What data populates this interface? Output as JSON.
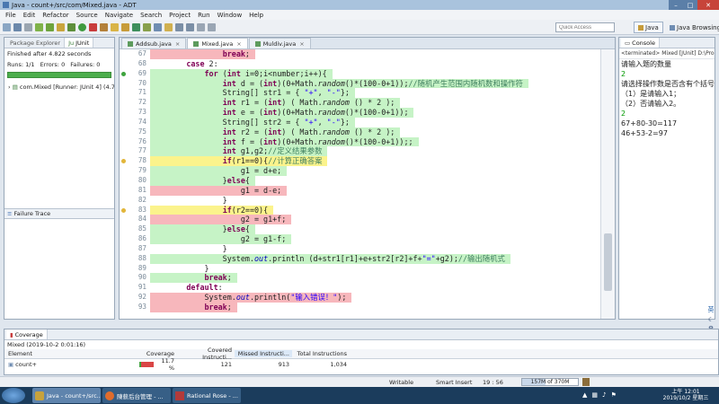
{
  "window": {
    "title": "Java - count+/src/com/Mixed.java - ADT"
  },
  "menu": [
    "File",
    "Edit",
    "Refactor",
    "Source",
    "Navigate",
    "Search",
    "Project",
    "Run",
    "Window",
    "Help"
  ],
  "toolbar": {
    "quick_access_placeholder": "Quick Access",
    "perspectives": [
      "Java",
      "Java Browsing"
    ]
  },
  "left_panel": {
    "tabs": [
      "Package Explorer",
      "JUnit"
    ],
    "finished": "Finished after 4.822 seconds",
    "runs": "Runs: 1/1",
    "errors": "Errors: 0",
    "failures": "Failures: 0",
    "tree_item": "com.Mixed [Runner: JUnit 4] (4.702",
    "failure_trace": "Failure Trace"
  },
  "editor": {
    "tabs": [
      "Addsub.java",
      "Mixed.java",
      "Muldiv.java"
    ],
    "active_tab": 1,
    "lines": [
      {
        "n": "67",
        "cov": "red",
        "code": "                break;"
      },
      {
        "n": "68",
        "cov": "",
        "code": "        case 2:"
      },
      {
        "n": "69",
        "cov": "green",
        "code": "            for (int i=0;i<number;i++){"
      },
      {
        "n": "70",
        "cov": "green",
        "code": "                int d = (int)(0+Math.random()*(100-0+1));//随机产生范围内随机数和操作符"
      },
      {
        "n": "71",
        "cov": "green",
        "code": "                String[] str1 = { \"+\", \"-\"};"
      },
      {
        "n": "72",
        "cov": "green",
        "code": "                int r1 = (int) ( Math.random () * 2 );"
      },
      {
        "n": "73",
        "cov": "green",
        "code": "                int e = (int)(0+Math.random()*(100-0+1));"
      },
      {
        "n": "74",
        "cov": "green",
        "code": "                String[] str2 = { \"+\", \"-\"};"
      },
      {
        "n": "75",
        "cov": "green",
        "code": "                int r2 = (int) ( Math.random () * 2 );"
      },
      {
        "n": "76",
        "cov": "green",
        "code": "                int f = (int)(0+Math.random()*(100-0+1));;"
      },
      {
        "n": "77",
        "cov": "green",
        "code": "                int g1,g2;//定义结果参数"
      },
      {
        "n": "78",
        "cov": "yellow",
        "code": "                if(r1==0){//计算正确答案"
      },
      {
        "n": "79",
        "cov": "green",
        "code": "                    g1 = d+e;"
      },
      {
        "n": "80",
        "cov": "green",
        "code": "                }else{"
      },
      {
        "n": "81",
        "cov": "red",
        "code": "                    g1 = d-e;"
      },
      {
        "n": "82",
        "cov": "",
        "code": "                }"
      },
      {
        "n": "83",
        "cov": "yellow",
        "code": "                if(r2==0){"
      },
      {
        "n": "84",
        "cov": "red",
        "code": "                    g2 = g1+f;"
      },
      {
        "n": "85",
        "cov": "green",
        "code": "                }else{"
      },
      {
        "n": "86",
        "cov": "green",
        "code": "                    g2 = g1-f;"
      },
      {
        "n": "87",
        "cov": "",
        "code": "                }"
      },
      {
        "n": "88",
        "cov": "green",
        "code": "                System.out.println (d+str1[r1]+e+str2[r2]+f+\"=\"+g2);//输出随机式"
      },
      {
        "n": "89",
        "cov": "",
        "code": "            }"
      },
      {
        "n": "90",
        "cov": "green",
        "code": "            break;"
      },
      {
        "n": "91",
        "cov": "",
        "code": "        default:"
      },
      {
        "n": "92",
        "cov": "red",
        "code": "            System.out.println(\"输入错误！\");"
      },
      {
        "n": "93",
        "cov": "red",
        "code": "            break;"
      }
    ]
  },
  "console": {
    "tab": "Console",
    "terminated": "<terminated> Mixed [JUnit] D:\\Prog",
    "lines": [
      {
        "t": "请输入题的数量",
        "in": false
      },
      {
        "t": "2",
        "in": true
      },
      {
        "t": "请选择操作数是否含有个括号",
        "in": false
      },
      {
        "t": "（1）是请输入1；",
        "in": false
      },
      {
        "t": "（2）否请输入2。",
        "in": false
      },
      {
        "t": "2",
        "in": true
      },
      {
        "t": "67+80-30=117",
        "in": false
      },
      {
        "t": "46+53-2=97",
        "in": false
      }
    ]
  },
  "coverage": {
    "tab": "Coverage",
    "session": "Mixed (2019-10-2 0:01:16)",
    "headers": [
      "Element",
      "Coverage",
      "Covered Instructi...",
      "Missed Instructi...",
      "Total Instructions"
    ],
    "row": {
      "element": "count+",
      "coverage": "11.7 %",
      "coverage_fraction": 0.117,
      "covered": "121",
      "missed": "913",
      "total": "1,034"
    }
  },
  "status": {
    "writable": "Writable",
    "insert": "Smart Insert",
    "position": "19 : 56",
    "memory": "157M of 370M",
    "memory_fraction": 0.42
  },
  "taskbar": {
    "items": [
      {
        "label": "Java - count+/src...",
        "active": true
      },
      {
        "label": "陳薪后台管理 - ...",
        "active": false
      },
      {
        "label": "Rational Rose - ...",
        "active": false
      }
    ],
    "ampm": "上午",
    "time": "12:01",
    "date": "2019/10/2 星期三"
  },
  "colors": {
    "cov_green": "#c6f3c6",
    "cov_red": "#f7b7bc",
    "cov_yellow": "#fbf38c",
    "taskbar": "#1b3c5c"
  }
}
